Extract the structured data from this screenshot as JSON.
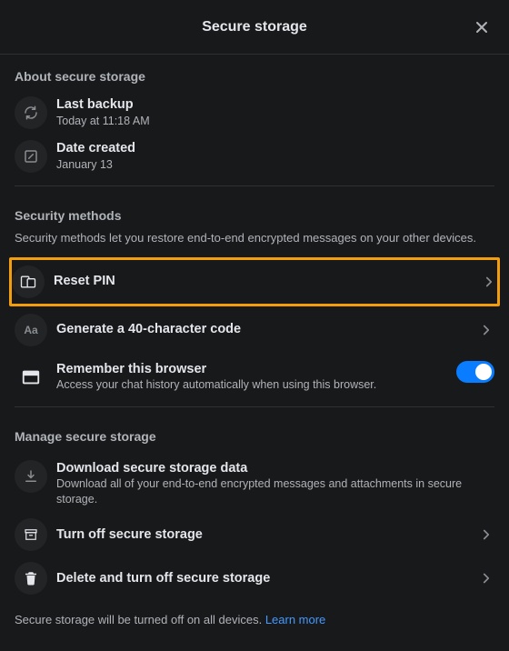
{
  "header": {
    "title": "Secure storage"
  },
  "about": {
    "section_title": "About secure storage",
    "last_backup": {
      "label": "Last backup",
      "value": "Today at 11:18 AM"
    },
    "date_created": {
      "label": "Date created",
      "value": "January 13"
    }
  },
  "security": {
    "section_title": "Security methods",
    "section_desc": "Security methods let you restore end-to-end encrypted messages on your other devices.",
    "reset_pin": {
      "label": "Reset PIN"
    },
    "generate_code": {
      "label": "Generate a 40-character code"
    },
    "remember_browser": {
      "label": "Remember this browser",
      "sub": "Access your chat history automatically when using this browser.",
      "on": true
    }
  },
  "manage": {
    "section_title": "Manage secure storage",
    "download": {
      "label": "Download secure storage data",
      "sub": "Download all of your end-to-end encrypted messages and attachments in secure storage."
    },
    "turn_off": {
      "label": "Turn off secure storage"
    },
    "delete_off": {
      "label": "Delete and turn off secure storage"
    },
    "footer_text": "Secure storage will be turned off on all devices. ",
    "learn_more": "Learn more"
  }
}
